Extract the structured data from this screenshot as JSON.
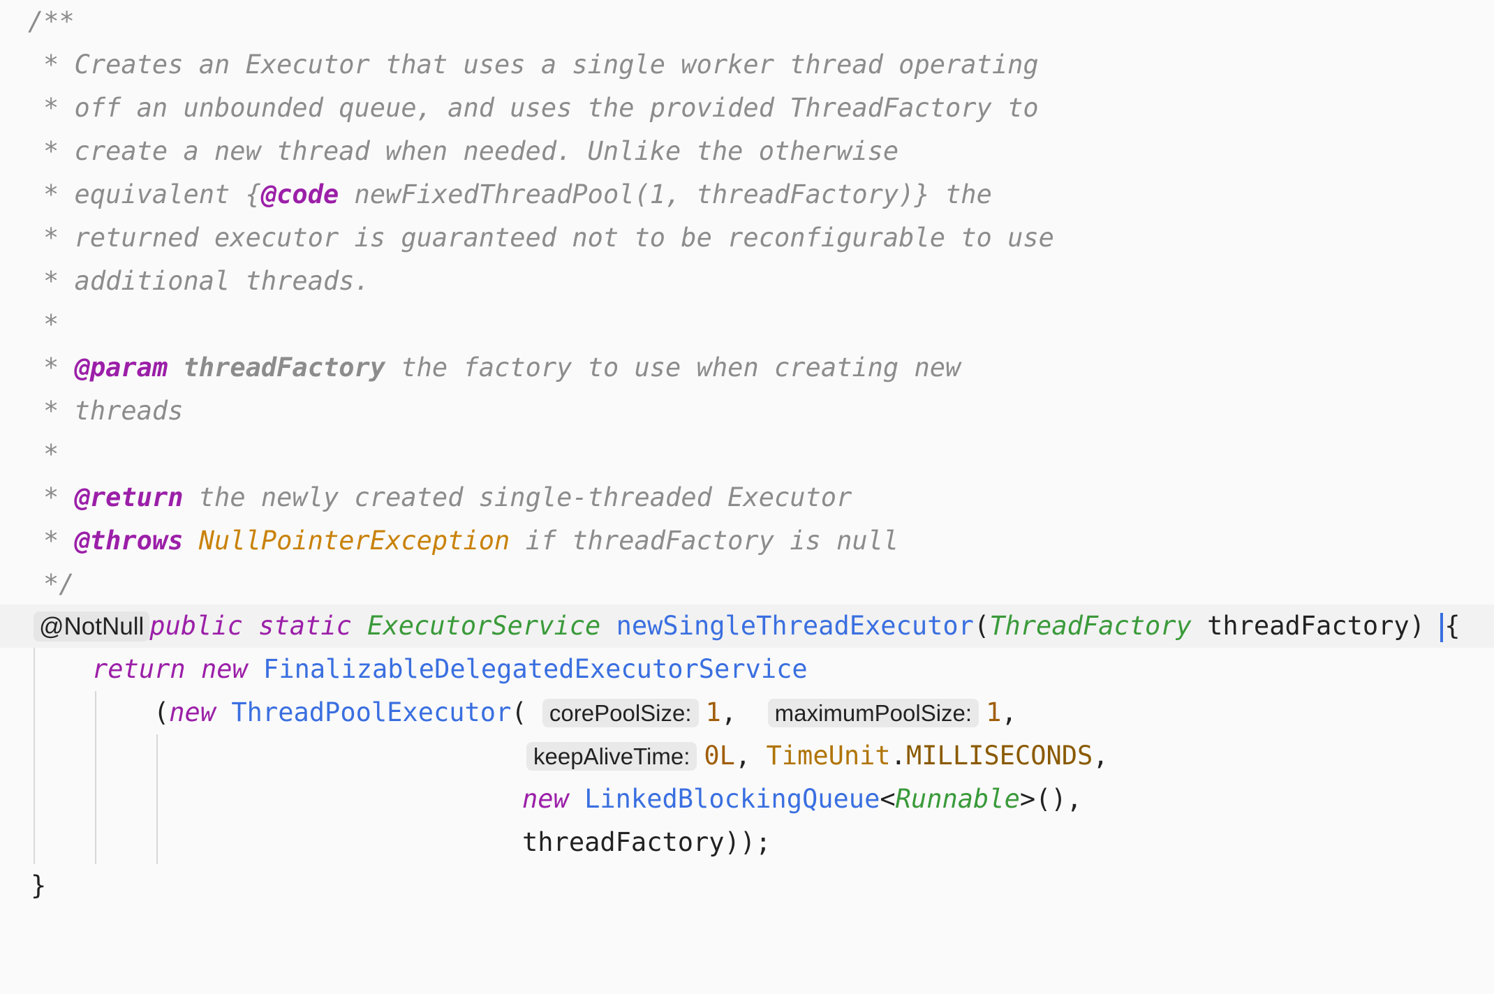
{
  "comment": {
    "open": "/**",
    "line1": "* Creates an Executor that uses a single worker thread operating",
    "line2": "* off an unbounded queue, and uses the provided ThreadFactory to",
    "line3": "* create a new thread when needed. Unlike the otherwise",
    "line4_a": "* equivalent {",
    "line4_tag": "@code",
    "line4_b": " newFixedThreadPool(1, threadFactory)} the",
    "line5": "* returned executor is guaranteed not to be reconfigurable to use",
    "line6": "* additional threads.",
    "blank1": "*",
    "param_star": "* ",
    "param_tag": "@param",
    "param_name": " threadFactory",
    "param_desc": " the factory to use when creating new",
    "param_cont": "* threads",
    "blank2": "*",
    "return_star": "* ",
    "return_tag": "@return",
    "return_desc": " the newly created single-threaded Executor",
    "throws_star": "* ",
    "throws_tag": "@throws",
    "throws_exc": " NullPointerException",
    "throws_desc": " if threadFactory is null",
    "close": "*/"
  },
  "signature": {
    "annotation": "@NotNull",
    "kw_public": "public",
    "kw_static": "static",
    "return_type": "ExecutorService",
    "method": "newSingleThreadExecutor",
    "open_paren": "(",
    "param_type": "ThreadFactory",
    "param_name": "threadFactory",
    "close_paren": ")",
    "brace": "{"
  },
  "body": {
    "kw_return": "return",
    "kw_new1": "new",
    "cls_outer": "FinalizableDelegatedExecutorService",
    "open1": "(",
    "kw_new2": "new",
    "cls_pool": "ThreadPoolExecutor",
    "open2": "(",
    "hint_core": "corePoolSize:",
    "val_core": "1",
    "comma1": ",",
    "hint_max": "maximumPoolSize:",
    "val_max": "1",
    "comma2": ",",
    "hint_keep": "keepAliveTime:",
    "val_keep": "0L",
    "comma3": ", ",
    "enum_cls": "TimeUnit",
    "dot": ".",
    "enum_val": "MILLISECONDS",
    "comma4": ",",
    "kw_new3": "new",
    "cls_queue": "LinkedBlockingQueue",
    "lt": "<",
    "generic_type": "Runnable",
    "gt_call": ">(),",
    "last_arg": "threadFactory));",
    "closing_brace": "}"
  }
}
